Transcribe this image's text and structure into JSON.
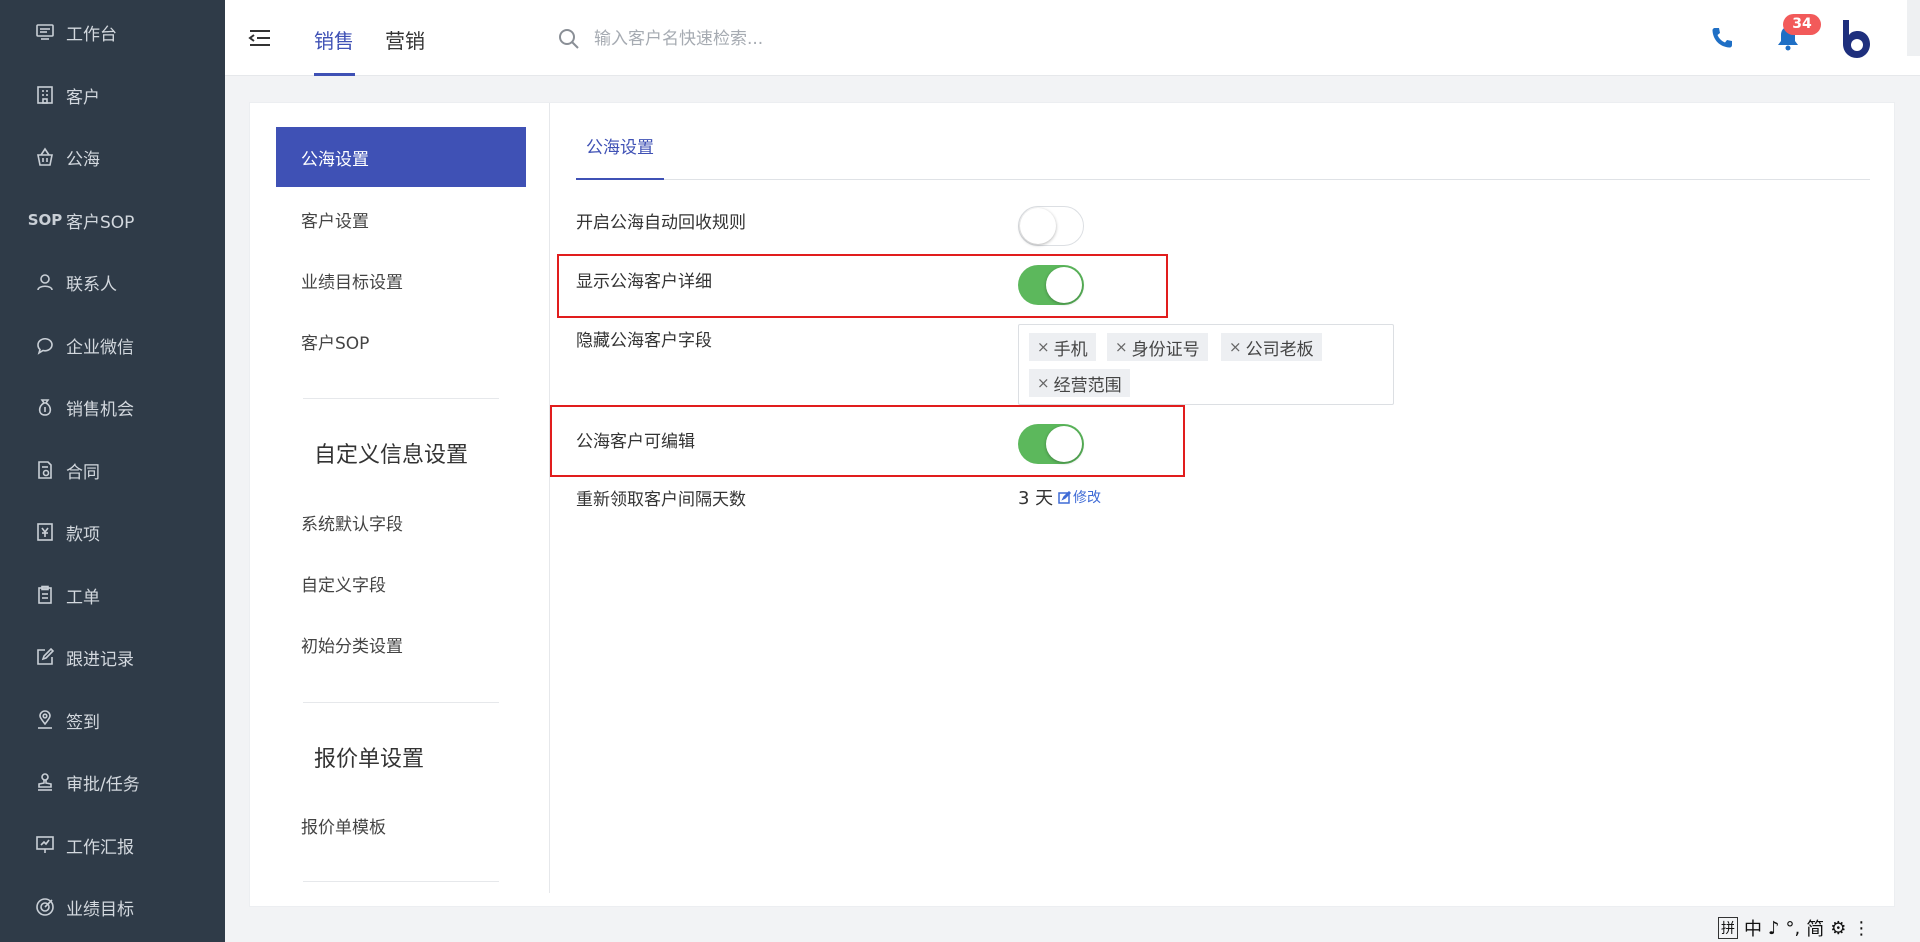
{
  "sidebar": {
    "items": [
      {
        "label": "工作台",
        "icon": "monitor-icon"
      },
      {
        "label": "客户",
        "icon": "building-icon"
      },
      {
        "label": "公海",
        "icon": "basket-icon"
      },
      {
        "label": "客户SOP",
        "icon": "sop-icon"
      },
      {
        "label": "联系人",
        "icon": "user-icon"
      },
      {
        "label": "企业微信",
        "icon": "chat-icon"
      },
      {
        "label": "销售机会",
        "icon": "money-bag-icon"
      },
      {
        "label": "合同",
        "icon": "contract-icon"
      },
      {
        "label": "款项",
        "icon": "yen-icon"
      },
      {
        "label": "工单",
        "icon": "clipboard-icon"
      },
      {
        "label": "跟进记录",
        "icon": "edit-icon"
      },
      {
        "label": "签到",
        "icon": "location-icon"
      },
      {
        "label": "审批/任务",
        "icon": "stamp-icon"
      },
      {
        "label": "工作汇报",
        "icon": "presentation-icon"
      },
      {
        "label": "业绩目标",
        "icon": "target-icon"
      }
    ]
  },
  "header": {
    "tabs": [
      {
        "label": "销售",
        "active": true
      },
      {
        "label": "营销",
        "active": false
      }
    ],
    "search_placeholder": "输入客户名快速检索...",
    "notification_count": "34",
    "accent_color": "#3f51b5"
  },
  "settings_nav": {
    "groups": [
      {
        "items": [
          "公海设置",
          "客户设置",
          "业绩目标设置",
          "客户SOP"
        ],
        "active": "公海设置"
      },
      {
        "title": "自定义信息设置",
        "items": [
          "系统默认字段",
          "自定义字段",
          "初始分类设置"
        ]
      },
      {
        "title": "报价单设置",
        "items": [
          "报价单模板"
        ]
      }
    ]
  },
  "content": {
    "tab_label": "公海设置",
    "rows": {
      "auto_recycle": {
        "label": "开启公海自动回收规则",
        "enabled": false
      },
      "show_detail": {
        "label": "显示公海客户详细",
        "enabled": true
      },
      "hidden_fields": {
        "label": "隐藏公海客户字段",
        "tags": [
          "手机",
          "身份证号",
          "公司老板",
          "经营范围"
        ]
      },
      "editable": {
        "label": "公海客户可编辑",
        "enabled": true
      },
      "reclaim_interval": {
        "label": "重新领取客户间隔天数",
        "value": "3 天",
        "edit_label": "修改"
      }
    },
    "toggle_on_color": "#5cb85c",
    "highlight_color": "#e11d1d"
  },
  "ime": {
    "items": [
      "拼",
      "中",
      "♪",
      "°,",
      "简",
      "⚙",
      "⋮"
    ]
  }
}
